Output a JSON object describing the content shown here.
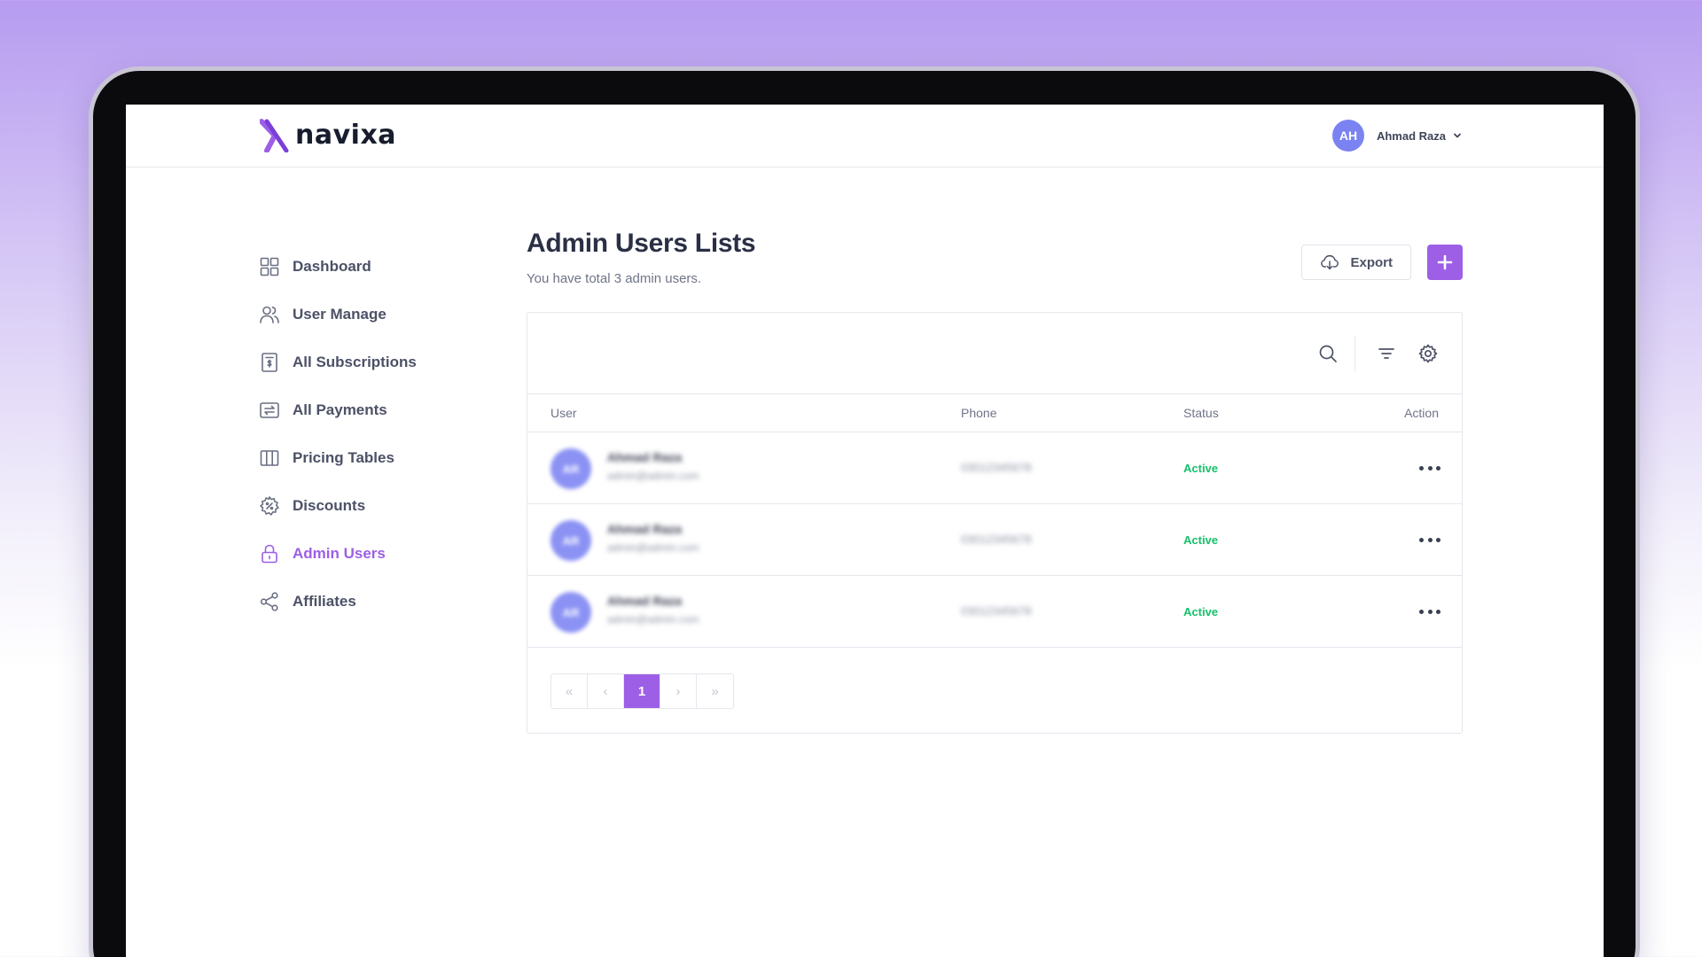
{
  "brand": {
    "name": "navixa",
    "accent": "#9d5fe6"
  },
  "user": {
    "initials": "AH",
    "name": "Ahmad Raza"
  },
  "sidebar": {
    "items": [
      {
        "label": "Dashboard",
        "icon": "dashboard-icon"
      },
      {
        "label": "User Manage",
        "icon": "users-icon"
      },
      {
        "label": "All Subscriptions",
        "icon": "receipt-icon"
      },
      {
        "label": "All Payments",
        "icon": "payments-icon"
      },
      {
        "label": "Pricing Tables",
        "icon": "columns-icon"
      },
      {
        "label": "Discounts",
        "icon": "discount-gear-icon"
      },
      {
        "label": "Admin Users",
        "icon": "lock-icon",
        "active": true
      },
      {
        "label": "Affiliates",
        "icon": "share-icon"
      }
    ]
  },
  "main": {
    "title": "Admin Users Lists",
    "subtitle": "You have total 3 admin users.",
    "export_label": "Export"
  },
  "table": {
    "columns": [
      "User",
      "Phone",
      "Status",
      "Action"
    ],
    "rows": [
      {
        "initials": "AR",
        "name": "Ahmad Raza",
        "email": "admin@admin.com",
        "phone": "03012345678",
        "status": "Active"
      },
      {
        "initials": "AR",
        "name": "Ahmad Raza",
        "email": "admin@admin.com",
        "phone": "03012345678",
        "status": "Active"
      },
      {
        "initials": "AR",
        "name": "Ahmad Raza",
        "email": "admin@admin.com",
        "phone": "03012345678",
        "status": "Active"
      }
    ],
    "status_color": "#16c06a"
  },
  "pagination": {
    "first": "«",
    "prev": "‹",
    "current": "1",
    "next": "›",
    "last": "»"
  }
}
